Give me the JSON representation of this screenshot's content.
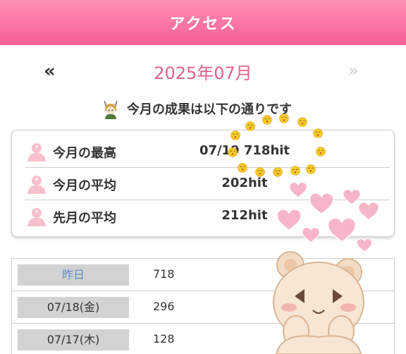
{
  "header": {
    "title": "アクセス"
  },
  "month_nav": {
    "prev": "«",
    "current": "2025年07月",
    "next": "»"
  },
  "summary": {
    "text": "今月の成果は以下の通りです",
    "character_icon": "anime-character-icon"
  },
  "stats": [
    {
      "label": "今月の最高",
      "value": "07/19 718hit",
      "icon": "person-silhouette-icon"
    },
    {
      "label": "今月の平均",
      "value": "202hit",
      "icon": "person-silhouette-icon"
    },
    {
      "label": "先月の平均",
      "value": "212hit",
      "icon": "person-silhouette-icon"
    }
  ],
  "daily": [
    {
      "date": "昨日",
      "count": "718"
    },
    {
      "date": "07/18(金)",
      "count": "296"
    },
    {
      "date": "07/17(木)",
      "count": "128"
    }
  ],
  "colors": {
    "header_gradient_top": "#ff8fb5",
    "header_gradient_bottom": "#f75f95",
    "month_text": "#e0608e",
    "today_text": "#5b8fd4",
    "date_cell_bg": "#d2d2d2",
    "heart_pink": "#f7b6c8",
    "emoji_yellow": "#f5c92a"
  },
  "decorations": {
    "emoji_ring": "kissing-face-emoji-ring",
    "hearts": "pink-hearts",
    "bear": "bear-sticker"
  }
}
